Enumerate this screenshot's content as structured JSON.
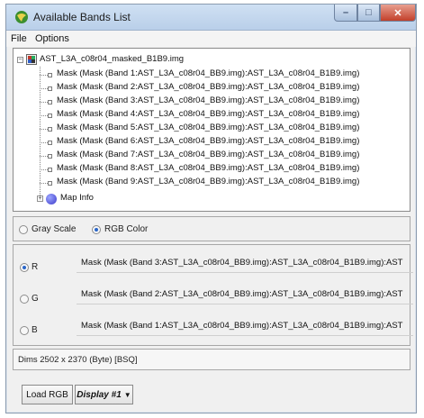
{
  "window": {
    "title": "Available Bands List"
  },
  "menu": {
    "file": "File",
    "options": "Options"
  },
  "tree": {
    "file_name": "AST_L3A_c08r04_masked_B1B9.img",
    "bands": [
      "Mask (Mask (Band 1:AST_L3A_c08r04_BB9.img):AST_L3A_c08r04_B1B9.img)",
      "Mask (Mask (Band 2:AST_L3A_c08r04_BB9.img):AST_L3A_c08r04_B1B9.img)",
      "Mask (Mask (Band 3:AST_L3A_c08r04_BB9.img):AST_L3A_c08r04_B1B9.img)",
      "Mask (Mask (Band 4:AST_L3A_c08r04_BB9.img):AST_L3A_c08r04_B1B9.img)",
      "Mask (Mask (Band 5:AST_L3A_c08r04_BB9.img):AST_L3A_c08r04_B1B9.img)",
      "Mask (Mask (Band 6:AST_L3A_c08r04_BB9.img):AST_L3A_c08r04_B1B9.img)",
      "Mask (Mask (Band 7:AST_L3A_c08r04_BB9.img):AST_L3A_c08r04_B1B9.img)",
      "Mask (Mask (Band 8:AST_L3A_c08r04_BB9.img):AST_L3A_c08r04_B1B9.img)",
      "Mask (Mask (Band 9:AST_L3A_c08r04_BB9.img):AST_L3A_c08r04_B1B9.img)"
    ],
    "map_info": "Map Info"
  },
  "mode": {
    "gray_scale": "Gray Scale",
    "rgb_color": "RGB Color",
    "selected": "rgb_color"
  },
  "rgb": {
    "r_label": "R",
    "r_band": "Mask (Mask (Band 3:AST_L3A_c08r04_BB9.img):AST_L3A_c08r04_B1B9.img):AST",
    "g_label": "G",
    "g_band": "Mask (Mask (Band 2:AST_L3A_c08r04_BB9.img):AST_L3A_c08r04_B1B9.img):AST",
    "b_label": "B",
    "b_band": "Mask (Mask (Band 1:AST_L3A_c08r04_BB9.img):AST_L3A_c08r04_B1B9.img):AST",
    "selected": "r"
  },
  "dims": {
    "text": "Dims 2502 x 2370 (Byte) [BSQ]"
  },
  "buttons": {
    "load_rgb": "Load RGB",
    "display": "Display #1"
  }
}
